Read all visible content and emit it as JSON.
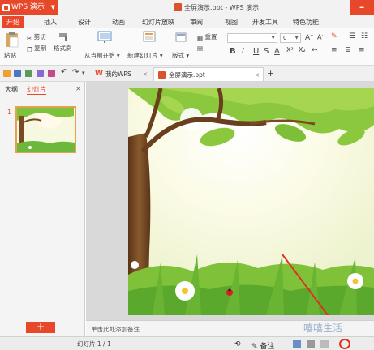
{
  "app": {
    "name": "WPS 演示",
    "window_title": "全屏演示.ppt - WPS 演示"
  },
  "ribbon_tabs": [
    "开始",
    "插入",
    "设计",
    "动画",
    "幻灯片放映",
    "审阅",
    "视图",
    "开发工具",
    "特色功能"
  ],
  "ribbon": {
    "paste": "粘贴",
    "cut": "剪切",
    "copy": "复制",
    "format_painter": "格式刷",
    "from_current": "从当前开始",
    "new_slide": "新建幻灯片",
    "layout": "版式",
    "reset": "重置",
    "font_size": "0",
    "format_buttons": [
      "B",
      "I",
      "U",
      "S",
      "A",
      "X²",
      "X₂"
    ]
  },
  "doc_tabs": {
    "home": "我的WPS",
    "current": "全屏演示.ppt"
  },
  "left_panel": {
    "outline_tab": "大纲",
    "slides_tab": "幻灯片",
    "slide_number": "1",
    "add_button": "+"
  },
  "notes_placeholder": "单击此处添加备注",
  "status": {
    "pages": "幻灯片 1 / 1",
    "notes": "备注"
  },
  "colors": {
    "accent": "#e8482a"
  },
  "watermark": "嘻嘻生活"
}
